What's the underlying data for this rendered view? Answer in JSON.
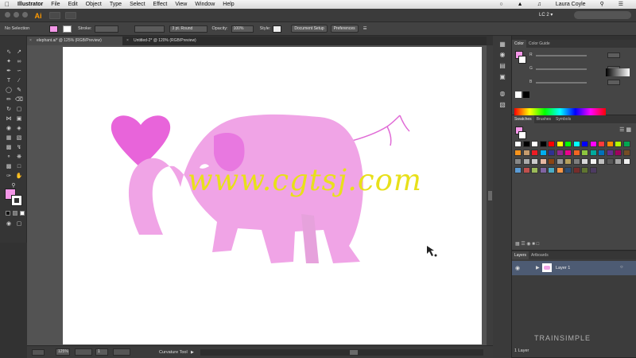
{
  "menubar": {
    "app_name": "Illustrator",
    "menus": [
      "File",
      "Edit",
      "Object",
      "Type",
      "Select",
      "Effect",
      "View",
      "Window",
      "Help"
    ],
    "user": "Laura Coyle"
  },
  "appbar": {
    "logo": "Ai",
    "workspace": "LC 2 ▾"
  },
  "control": {
    "selection": "No Selection",
    "stroke_label": "Stroke:",
    "brush": "3 pt. Round",
    "opacity_label": "Opacity:",
    "opacity_value": "100%",
    "style_label": "Style:",
    "doc_setup": "Document Setup",
    "preferences": "Preferences"
  },
  "tabs": [
    {
      "label": "elephant.ai* @ 125% (RGB/Preview)",
      "active": true
    },
    {
      "label": "Untitled-2* @ 120% (RGB/Preview)",
      "active": false
    }
  ],
  "status": {
    "zoom": "125%",
    "artboard": "1",
    "tool": "Curvature Tool"
  },
  "color_panel": {
    "tabs": [
      "Color",
      "Color Guide"
    ],
    "channels": [
      "R",
      "G",
      "B"
    ]
  },
  "swatches_panel": {
    "tabs": [
      "Swatches",
      "Brushes",
      "Symbols"
    ]
  },
  "layers_panel": {
    "tabs": [
      "Layers",
      "Artboards"
    ],
    "layer_name": "Layer 1",
    "footer": "1 Layer"
  },
  "colors": {
    "elephant": "#f0a4e6",
    "elephant_dark": "#e878e0",
    "heart": "#e864da",
    "fill_swatch": "#f497e8"
  },
  "watermark": "www.cgtsj.com",
  "trainsimple": "TRAINSIMPLE"
}
